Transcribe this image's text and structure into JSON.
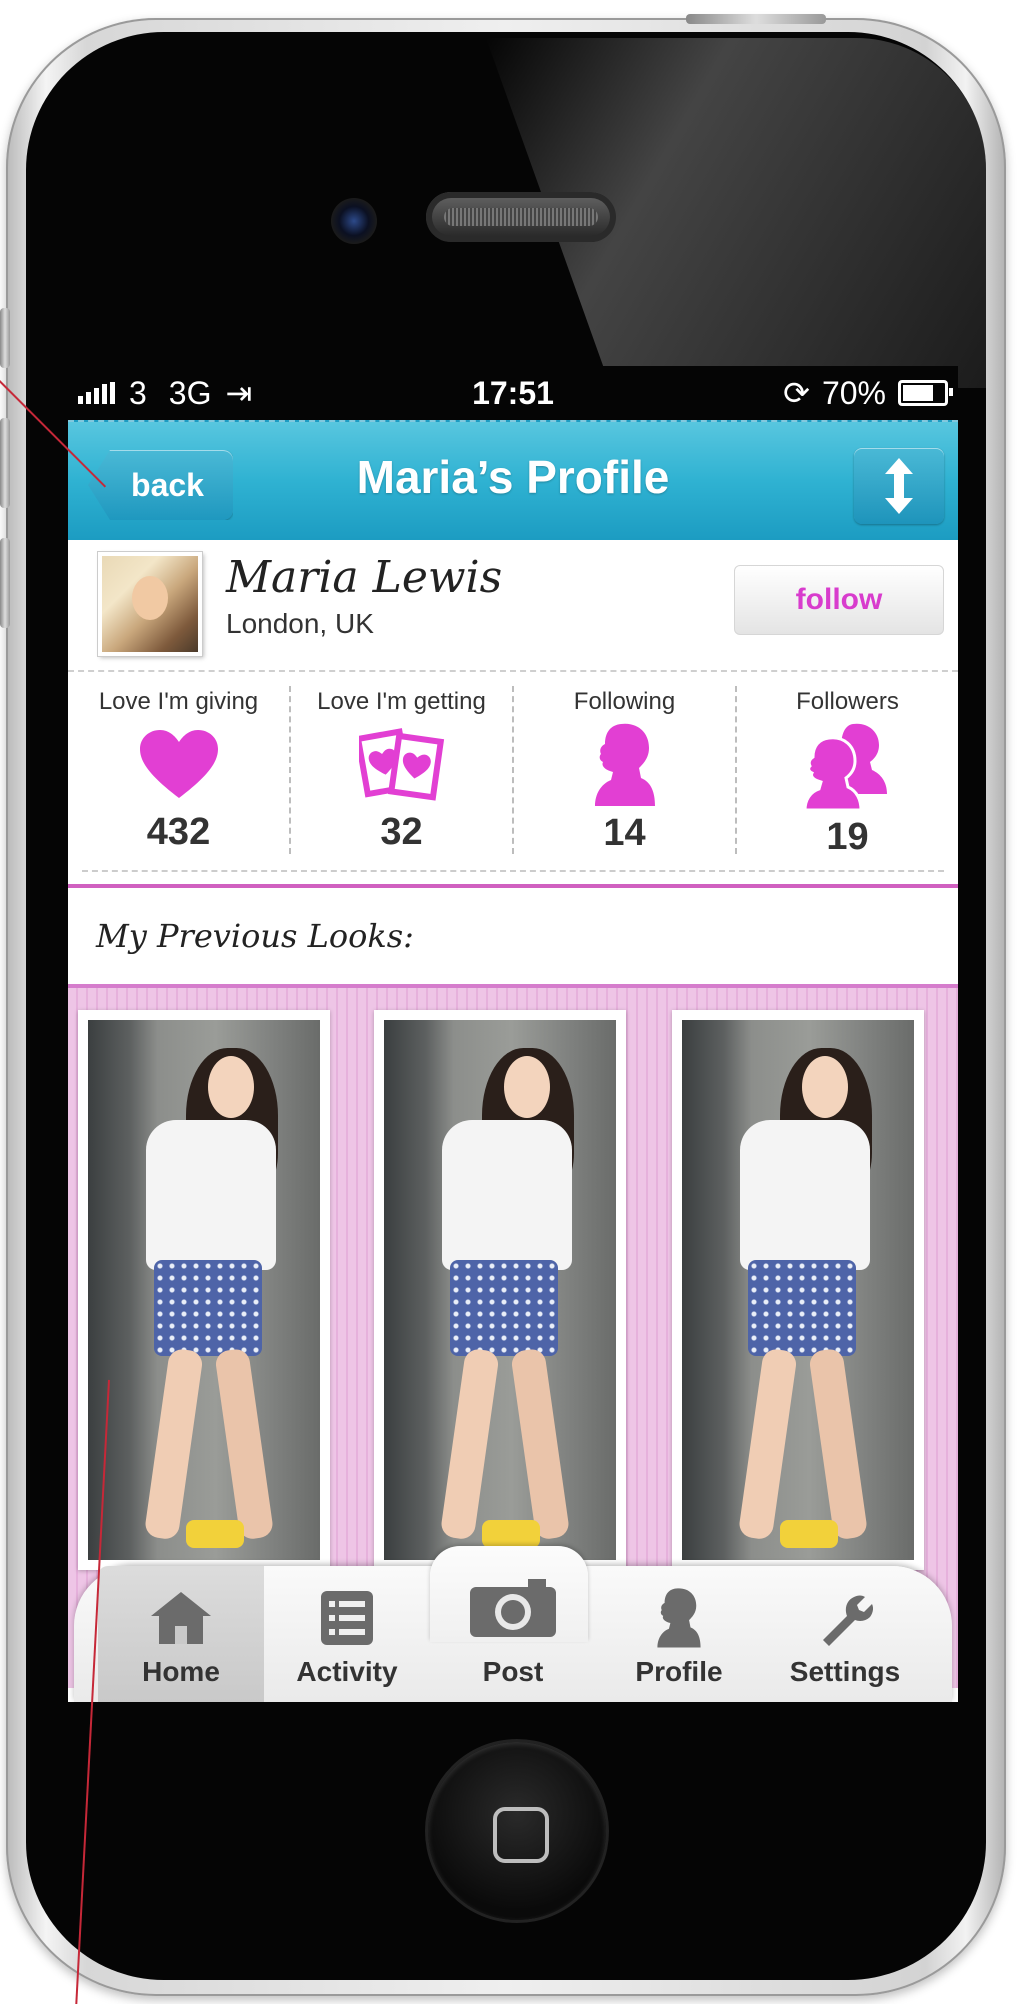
{
  "status_bar": {
    "carrier": "3",
    "network": "3G",
    "time": "17:51",
    "battery": "70%"
  },
  "nav": {
    "back_label": "back",
    "title": "Maria’s Profile",
    "sort_icon": "up-down-arrow-icon"
  },
  "profile": {
    "name": "Maria Lewis",
    "location": "London, UK",
    "follow_label": "follow"
  },
  "stats": [
    {
      "label": "Love I'm giving",
      "value": "432",
      "icon": "heart-icon"
    },
    {
      "label": "Love I'm getting",
      "value": "32",
      "icon": "photos-heart-icon"
    },
    {
      "label": "Following",
      "value": "14",
      "icon": "woman-silhouette-icon"
    },
    {
      "label": "Followers",
      "value": "19",
      "icon": "two-women-silhouette-icon"
    }
  ],
  "looks": {
    "title": "My Previous Looks:"
  },
  "tabbar": {
    "items": [
      {
        "label": "Home",
        "icon": "house-icon",
        "active": true
      },
      {
        "label": "Activity",
        "icon": "list-icon",
        "active": false
      },
      {
        "label": "Post",
        "icon": "camera-icon",
        "active": false
      },
      {
        "label": "Profile",
        "icon": "woman-silhouette-icon",
        "active": false
      },
      {
        "label": "Settings",
        "icon": "wrench-icon",
        "active": false
      }
    ]
  },
  "colors": {
    "accent_pink": "#e23fd3",
    "nav_blue": "#2fb2d2",
    "looks_bg": "#eec5e6"
  }
}
